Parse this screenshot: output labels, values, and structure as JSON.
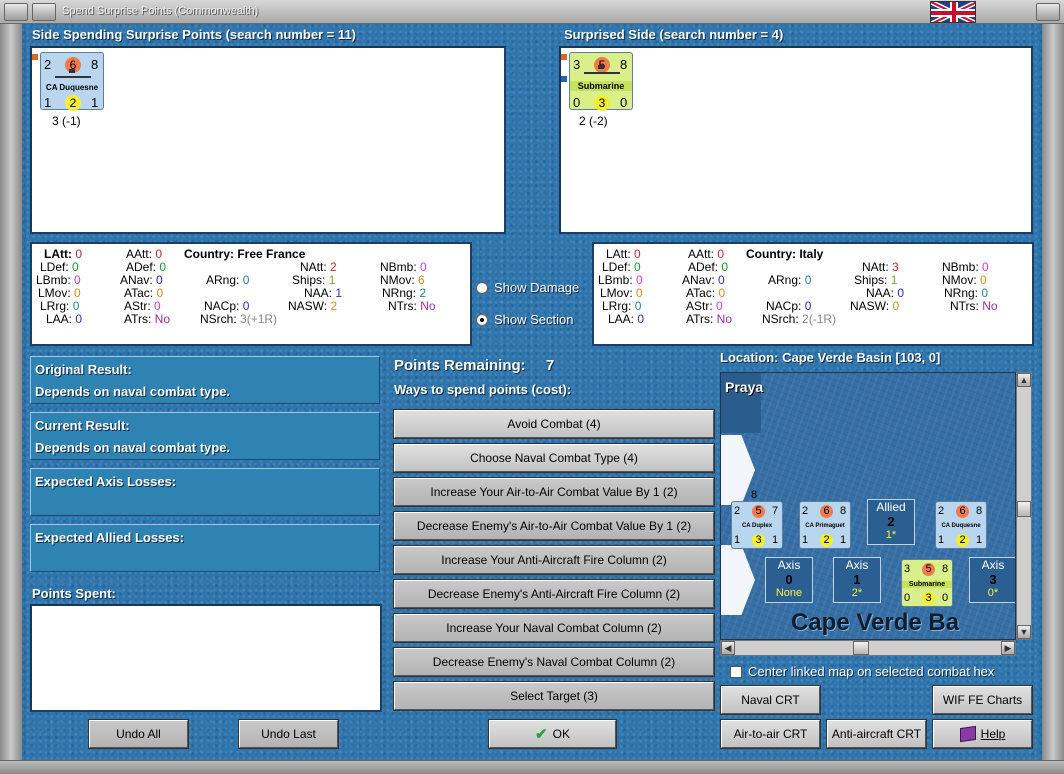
{
  "window": {
    "title": "Spend Surprise Points (Commonwealth)"
  },
  "spending_side": {
    "header": "Side Spending Surprise Points (search number = 11)",
    "unit": {
      "top_left": "2",
      "top_mid": "6",
      "top_right": "8",
      "name": "CA Duquesne",
      "bot_left": "1",
      "bot_mid": "2",
      "bot_right": "1",
      "caption": "3 (-1)"
    }
  },
  "surprised_side": {
    "header": "Surprised Side (search number = 4)",
    "unit": {
      "top_left": "3",
      "top_mid": "5",
      "top_right": "8",
      "name": "Submarine",
      "bot_left": "0",
      "bot_mid": "3",
      "bot_right": "0",
      "caption": "2 (-2)"
    }
  },
  "stats_left": {
    "country_label": "Country:",
    "country": "Free France",
    "LAtt": "0",
    "LDef": "0",
    "LBmb": "0",
    "LMov": "0",
    "LRrg": "0",
    "LAA": "0",
    "AAtt": "0",
    "ADef": "0",
    "ANav": "0",
    "ATac": "0",
    "AStr": "0",
    "ATrs": "No",
    "ARng": "0",
    "NACp": "0",
    "NSrch": "3(+1R)",
    "NAtt": "2",
    "Ships": "1",
    "NAA": "1",
    "NASW": "2",
    "NBmb": "0",
    "NMov": "6",
    "NRng": "2",
    "NTrs": "No"
  },
  "stats_right": {
    "country_label": "Country:",
    "country": "Italy",
    "LAtt": "0",
    "LDef": "0",
    "LBmb": "0",
    "LMov": "0",
    "LRrg": "0",
    "LAA": "0",
    "AAtt": "0",
    "ADef": "0",
    "ANav": "0",
    "ATac": "0",
    "AStr": "0",
    "ATrs": "No",
    "ARng": "0",
    "NACp": "0",
    "NSrch": "2(-1R)",
    "NAtt": "3",
    "Ships": "1",
    "NAA": "0",
    "NASW": "0",
    "NBmb": "0",
    "NMov": "0",
    "NRng": "0",
    "NTrs": "No"
  },
  "stat_labels": {
    "LAtt": "LAtt:",
    "LDef": "LDef:",
    "LBmb": "LBmb:",
    "LMov": "LMov:",
    "LRrg": "LRrg:",
    "LAA": "LAA:",
    "AAtt": "AAtt:",
    "ADef": "ADef:",
    "ANav": "ANav:",
    "ATac": "ATac:",
    "AStr": "AStr:",
    "ATrs": "ATrs:",
    "ARng": "ARng:",
    "NACp": "NACp:",
    "NSrch": "NSrch:",
    "NAtt": "NAtt:",
    "Ships": "Ships:",
    "NAA": "NAA:",
    "NASW": "NASW:",
    "NBmb": "NBmb:",
    "NMov": "NMov:",
    "NRng": "NRng:",
    "NTrs": "NTrs:"
  },
  "radios": {
    "show_damage": "Show Damage",
    "show_section": "Show Section"
  },
  "results": {
    "original_label": "Original Result:",
    "original_value": "Depends on naval combat type.",
    "current_label": "Current Result:",
    "current_value": "Depends on naval combat type.",
    "axis_losses_label": "Expected Axis Losses:",
    "allied_losses_label": "Expected Allied Losses:",
    "points_spent_label": "Points Spent:"
  },
  "points": {
    "remaining_label": "Points Remaining:",
    "remaining_value": "7",
    "ways_label": "Ways to spend points (cost):"
  },
  "options": [
    "Avoid Combat (4)",
    "Choose Naval Combat Type (4)",
    "Increase Your Air-to-Air Combat Value By 1 (2)",
    "Decrease Enemy's Air-to-Air Combat Value By 1 (2)",
    "Increase Your Anti-Aircraft Fire Column (2)",
    "Decrease Enemy's Anti-Aircraft Fire Column (2)",
    "Increase Your Naval Combat Column (2)",
    "Decrease Enemy's Naval Combat Column (2)",
    "Select Target (3)"
  ],
  "buttons": {
    "undo_all": "Undo All",
    "undo_last": "Undo Last",
    "ok": "OK",
    "naval_crt": "Naval CRT",
    "wif_fe_charts": "WIF FE Charts",
    "air_to_air_crt": "Air-to-air CRT",
    "anti_aircraft_crt": "Anti-aircraft CRT",
    "help": "Help"
  },
  "map": {
    "location": "Location: Cape Verde Basin [103, 0]",
    "place_label": "Praya",
    "sea_label": "Cape Verde Ba",
    "center_checkbox": "Center linked map on selected combat hex",
    "units": [
      {
        "tl": "2",
        "tm": "5",
        "tr": "7",
        "name": "CA Duplex",
        "bl": "1",
        "bm": "3",
        "br": "1",
        "stack": "8"
      },
      {
        "tl": "2",
        "tm": "6",
        "tr": "8",
        "name": "CA Primaguet",
        "bl": "1",
        "bm": "2",
        "br": "1"
      },
      {
        "tl": "2",
        "tm": "6",
        "tr": "8",
        "name": "CA Duquesne",
        "bl": "1",
        "bm": "2",
        "br": "1"
      },
      {
        "tl": "3",
        "tm": "5",
        "tr": "8",
        "name": "Submarine",
        "bl": "0",
        "bm": "3",
        "br": "0"
      }
    ],
    "allied_box": {
      "title": "Allied",
      "value": "2",
      "sub": "1*"
    },
    "axis_boxes": [
      {
        "title": "Axis",
        "value": "0",
        "sub": "None"
      },
      {
        "title": "Axis",
        "value": "1",
        "sub": "2*"
      },
      {
        "title": "Axis",
        "value": "3",
        "sub": "0*"
      }
    ]
  },
  "colors": {
    "panel_blue": "#2e74ad",
    "result_box": "#2f83b3",
    "unit_blue": "#b9d6ee",
    "unit_yellow": "#d9f08a",
    "accent_red": "#f07a4a",
    "accent_yellow": "#f4ef2c"
  }
}
